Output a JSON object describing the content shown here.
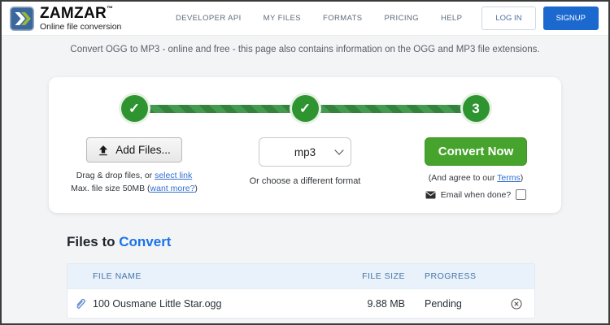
{
  "header": {
    "brand": {
      "name": "ZAMZAR",
      "tm": "™",
      "tagline": "Online file conversion"
    },
    "nav": [
      {
        "label": "DEVELOPER API"
      },
      {
        "label": "MY FILES"
      },
      {
        "label": "FORMATS"
      },
      {
        "label": "PRICING"
      },
      {
        "label": "HELP"
      }
    ],
    "login_label": "LOG IN",
    "signup_label": "SIGNUP"
  },
  "page": {
    "subtitle": "Convert OGG to MP3 - online and free - this page also contains information on the OGG and MP3 file extensions."
  },
  "converter": {
    "steps": [
      {
        "symbol": "✓",
        "state": "done"
      },
      {
        "symbol": "✓",
        "state": "done"
      },
      {
        "symbol": "3",
        "state": "current"
      }
    ],
    "add_files_label": "Add Files...",
    "drag_drop_prefix": "Drag & drop files, or ",
    "select_link_label": "select link",
    "max_size_prefix": "Max. file size 50MB (",
    "want_more_label": "want more?",
    "max_size_suffix": ")",
    "format_value": "mp3",
    "format_caption": "Or choose a different format",
    "convert_label": "Convert Now",
    "terms_prefix": "(And agree to our ",
    "terms_label": "Terms",
    "terms_suffix": ")",
    "email_label": "Email when done?"
  },
  "files": {
    "title_prefix": "Files to ",
    "title_accent": "Convert",
    "columns": [
      {
        "label": "FILE NAME"
      },
      {
        "label": "FILE SIZE"
      },
      {
        "label": "PROGRESS"
      }
    ],
    "rows": [
      {
        "file_name": "100 Ousmane Little Star.ogg",
        "file_size": "9.88 MB",
        "progress": "Pending"
      }
    ]
  },
  "colors": {
    "accent_blue": "#1a73e8",
    "signup_blue": "#1b69cf",
    "step_green": "#2e9430",
    "convert_green": "#46a42d",
    "table_header_bg": "#e9f1fa"
  }
}
